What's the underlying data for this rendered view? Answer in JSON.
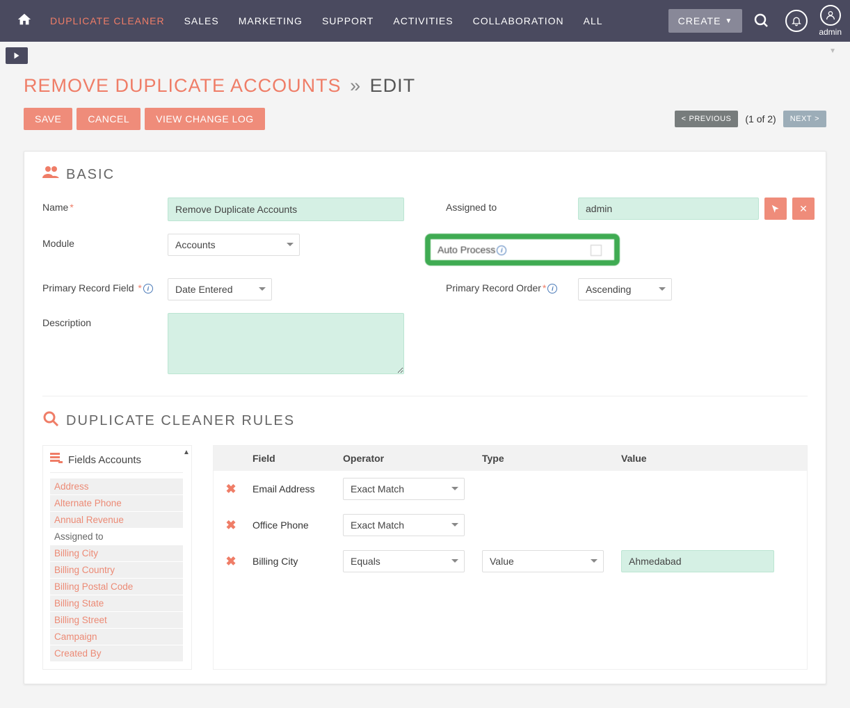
{
  "nav": {
    "items": [
      "DUPLICATE CLEANER",
      "SALES",
      "MARKETING",
      "SUPPORT",
      "ACTIVITIES",
      "COLLABORATION",
      "ALL"
    ],
    "create_label": "CREATE",
    "user_label": "admin"
  },
  "page": {
    "title_main": "REMOVE DUPLICATE ACCOUNTS",
    "title_sep": "»",
    "title_sub": "EDIT",
    "save": "SAVE",
    "cancel": "CANCEL",
    "view_log": "VIEW CHANGE LOG",
    "prev": "PREVIOUS",
    "pager": "(1 of 2)",
    "next": "NEXT"
  },
  "basic": {
    "heading": "BASIC",
    "name_label": "Name",
    "name_value": "Remove Duplicate Accounts",
    "assigned_label": "Assigned to",
    "assigned_value": "admin",
    "module_label": "Module",
    "module_value": "Accounts",
    "auto_label": "Auto Process",
    "primary_field_label": "Primary Record Field",
    "primary_field_value": "Date Entered",
    "primary_order_label": "Primary Record Order",
    "primary_order_value": "Ascending",
    "description_label": "Description",
    "description_value": ""
  },
  "rules": {
    "heading": "DUPLICATE CLEANER RULES",
    "fields_panel_title": "Fields Accounts",
    "field_items": [
      {
        "label": "Address",
        "linked": true
      },
      {
        "label": "Alternate Phone",
        "linked": true
      },
      {
        "label": "Annual Revenue",
        "linked": true
      },
      {
        "label": "Assigned to",
        "linked": false
      },
      {
        "label": "Billing City",
        "linked": true
      },
      {
        "label": "Billing Country",
        "linked": true
      },
      {
        "label": "Billing Postal Code",
        "linked": true
      },
      {
        "label": "Billing State",
        "linked": true
      },
      {
        "label": "Billing Street",
        "linked": true
      },
      {
        "label": "Campaign",
        "linked": true
      },
      {
        "label": "Created By",
        "linked": true
      }
    ],
    "columns": {
      "field": "Field",
      "operator": "Operator",
      "type": "Type",
      "value": "Value"
    },
    "rows": [
      {
        "field": "Email Address",
        "operator": "Exact Match",
        "type": "",
        "value": ""
      },
      {
        "field": "Office Phone",
        "operator": "Exact Match",
        "type": "",
        "value": ""
      },
      {
        "field": "Billing City",
        "operator": "Equals",
        "type": "Value",
        "value": "Ahmedabad"
      }
    ]
  }
}
